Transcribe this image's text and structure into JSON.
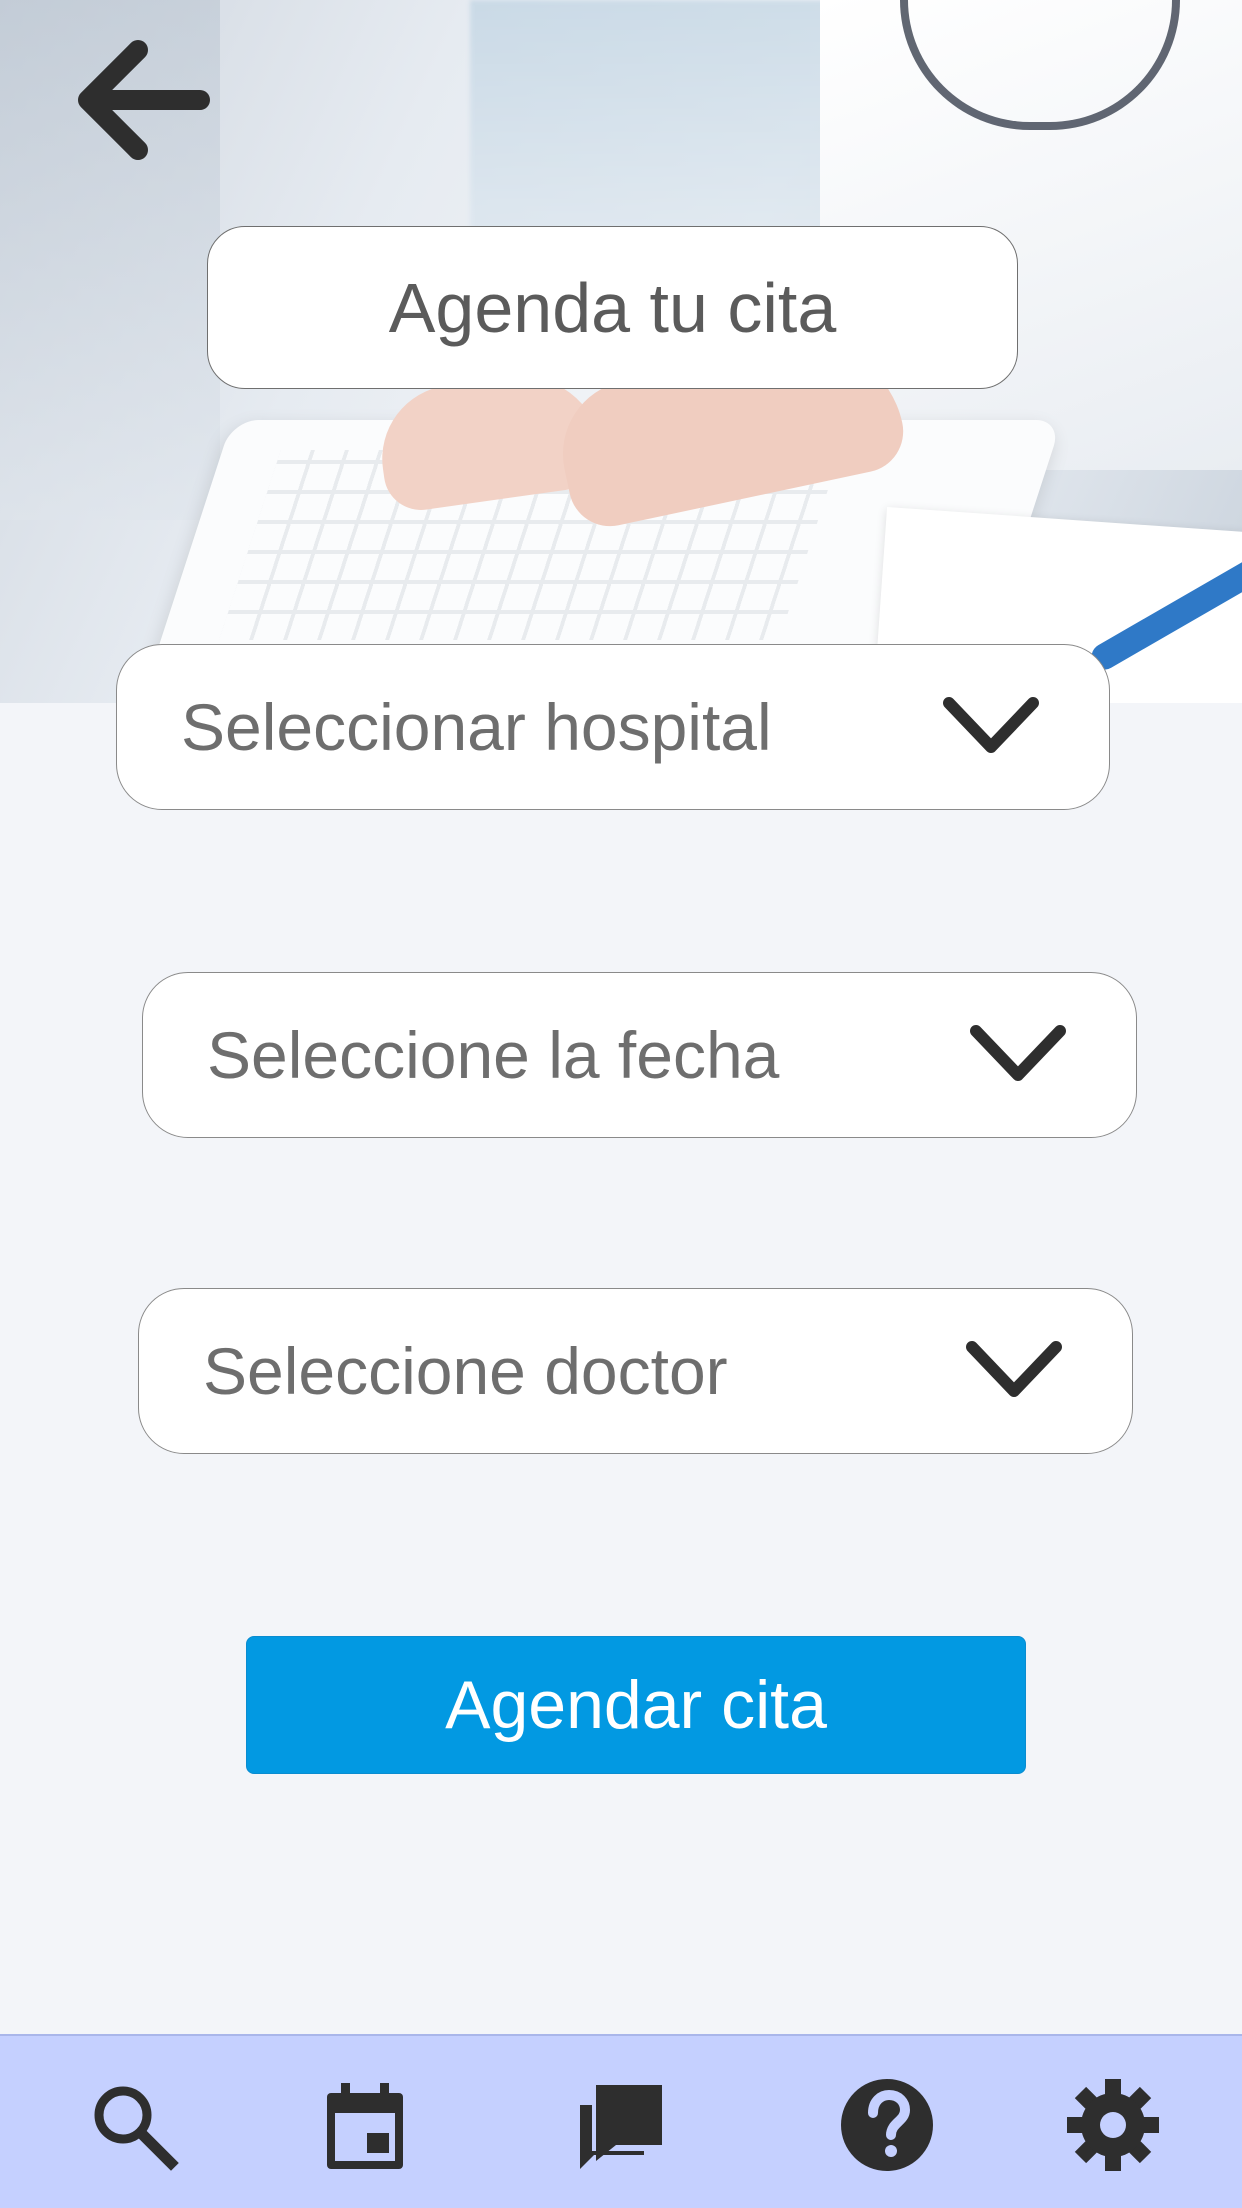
{
  "header": {
    "title": "Agenda tu cita",
    "back_icon": "arrow-left-icon"
  },
  "form": {
    "hospital_placeholder": "Seleccionar hospital",
    "date_placeholder": "Seleccione la fecha",
    "doctor_placeholder": "Seleccione doctor",
    "chevron_icon": "chevron-down-icon"
  },
  "actions": {
    "submit_label": "Agendar cita"
  },
  "bottom_nav": {
    "items": [
      {
        "icon": "search-icon"
      },
      {
        "icon": "calendar-icon"
      },
      {
        "icon": "chat-icon"
      },
      {
        "icon": "help-icon"
      },
      {
        "icon": "gear-icon"
      }
    ]
  },
  "colors": {
    "primary": "#0299e2",
    "nav_background": "#c5d0ff",
    "page_background": "#f3f5f9",
    "icon": "#2e2e2e"
  }
}
